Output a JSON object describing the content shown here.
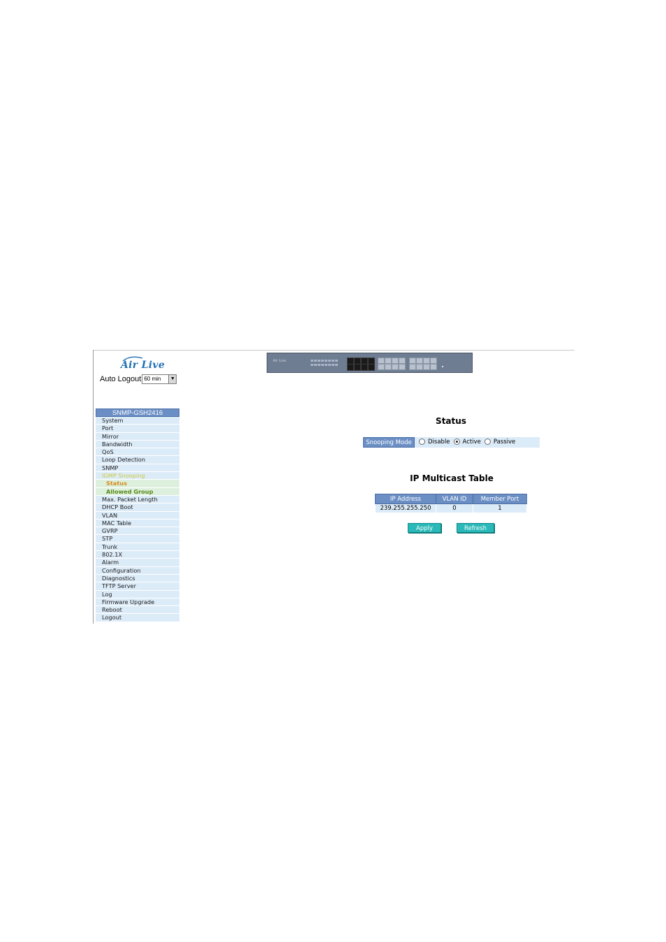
{
  "header": {
    "logo_text": "Air Live",
    "auto_logout_label": "Auto Logout",
    "auto_logout_value": "60 min"
  },
  "switch_image": {
    "brand": "Air Live"
  },
  "sidebar": {
    "title": "SNMP-GSH2416",
    "items": [
      {
        "label": "System"
      },
      {
        "label": "Port"
      },
      {
        "label": "Mirror"
      },
      {
        "label": "Bandwidth"
      },
      {
        "label": "QoS"
      },
      {
        "label": "Loop Detection"
      },
      {
        "label": "SNMP"
      },
      {
        "label": "IGMP Snooping",
        "active": true
      },
      {
        "label": "Status",
        "sub": true,
        "current": true
      },
      {
        "label": "Allowed Group",
        "sub": true
      },
      {
        "label": "Max. Packet Length"
      },
      {
        "label": "DHCP Boot"
      },
      {
        "label": "VLAN"
      },
      {
        "label": "MAC Table"
      },
      {
        "label": "GVRP"
      },
      {
        "label": "STP"
      },
      {
        "label": "Trunk"
      },
      {
        "label": "802.1X"
      },
      {
        "label": "Alarm"
      },
      {
        "label": "Configuration"
      },
      {
        "label": "Diagnostics"
      },
      {
        "label": "TFTP Server"
      },
      {
        "label": "Log"
      },
      {
        "label": "Firmware Upgrade"
      },
      {
        "label": "Reboot"
      },
      {
        "label": "Logout"
      }
    ]
  },
  "main": {
    "status_title": "Status",
    "snooping_mode_label": "Snooping Mode",
    "mode_options": [
      "Disable",
      "Active",
      "Passive"
    ],
    "selected_mode": "Active",
    "table_title": "IP Multicast Table",
    "table_headers": [
      "IP Address",
      "VLAN ID",
      "Member Port"
    ],
    "table_rows": [
      [
        "239.255.255.250",
        "0",
        "1"
      ]
    ],
    "apply_label": "Apply",
    "refresh_label": "Refresh"
  }
}
